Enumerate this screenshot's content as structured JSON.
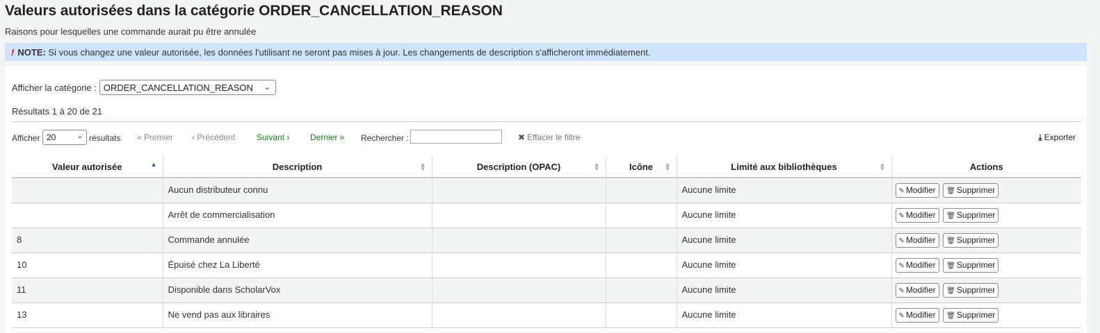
{
  "title": "Valeurs autorisées dans la catégorie ORDER_CANCELLATION_REASON",
  "subtitle": "Raisons pour lesquelles une commande aurait pu être annulée",
  "note": {
    "label": "NOTE:",
    "text": " Si vous changez une valeur autorisée, les données l'utilisant ne seront pas mises à jour. Les changements de description s'afficheront immédiatement."
  },
  "category": {
    "label": "Afficher la catégorie :",
    "selected": "ORDER_CANCELLATION_REASON"
  },
  "results_summary": "Résultats 1 à 20 de 21",
  "toolbar": {
    "show_label": "Afficher",
    "page_size": "20",
    "results_label": "résultats",
    "first": "« Premier",
    "previous": "‹ Précédent",
    "next": "Suivant ›",
    "last": "Dernier »",
    "search_label": "Rechercher :",
    "search_value": "",
    "clear_filter": "Effacer le filtre",
    "export": "Exporter"
  },
  "table": {
    "headers": [
      "Valeur autorisée",
      "Description",
      "Description (OPAC)",
      "Icône",
      "Limité aux bibliothèques",
      "Actions"
    ],
    "edit_label": "Modifier",
    "delete_label": "Supprimer",
    "rows": [
      {
        "value": "",
        "description": "Aucun distributeur connu",
        "opac": "",
        "icon": "",
        "libraries": "Aucune limite"
      },
      {
        "value": "",
        "description": "Arrêt de commercialisation",
        "opac": "",
        "icon": "",
        "libraries": "Aucune limite"
      },
      {
        "value": "8",
        "description": "Commande annulée",
        "opac": "",
        "icon": "",
        "libraries": "Aucune limite"
      },
      {
        "value": "10",
        "description": "Épuisé chez La Liberté",
        "opac": "",
        "icon": "",
        "libraries": "Aucune limite"
      },
      {
        "value": "11",
        "description": "Disponible dans ScholarVox",
        "opac": "",
        "icon": "",
        "libraries": "Aucune limite"
      },
      {
        "value": "13",
        "description": "Ne vend pas aux libraires",
        "opac": "",
        "icon": "",
        "libraries": "Aucune limite"
      }
    ]
  },
  "icons": {
    "note": "exclamation-icon",
    "clear": "times-icon",
    "export": "download-icon",
    "edit": "pencil-icon",
    "delete": "trash-icon",
    "sort": "sort-icon",
    "sort_asc": "sort-asc-icon"
  }
}
